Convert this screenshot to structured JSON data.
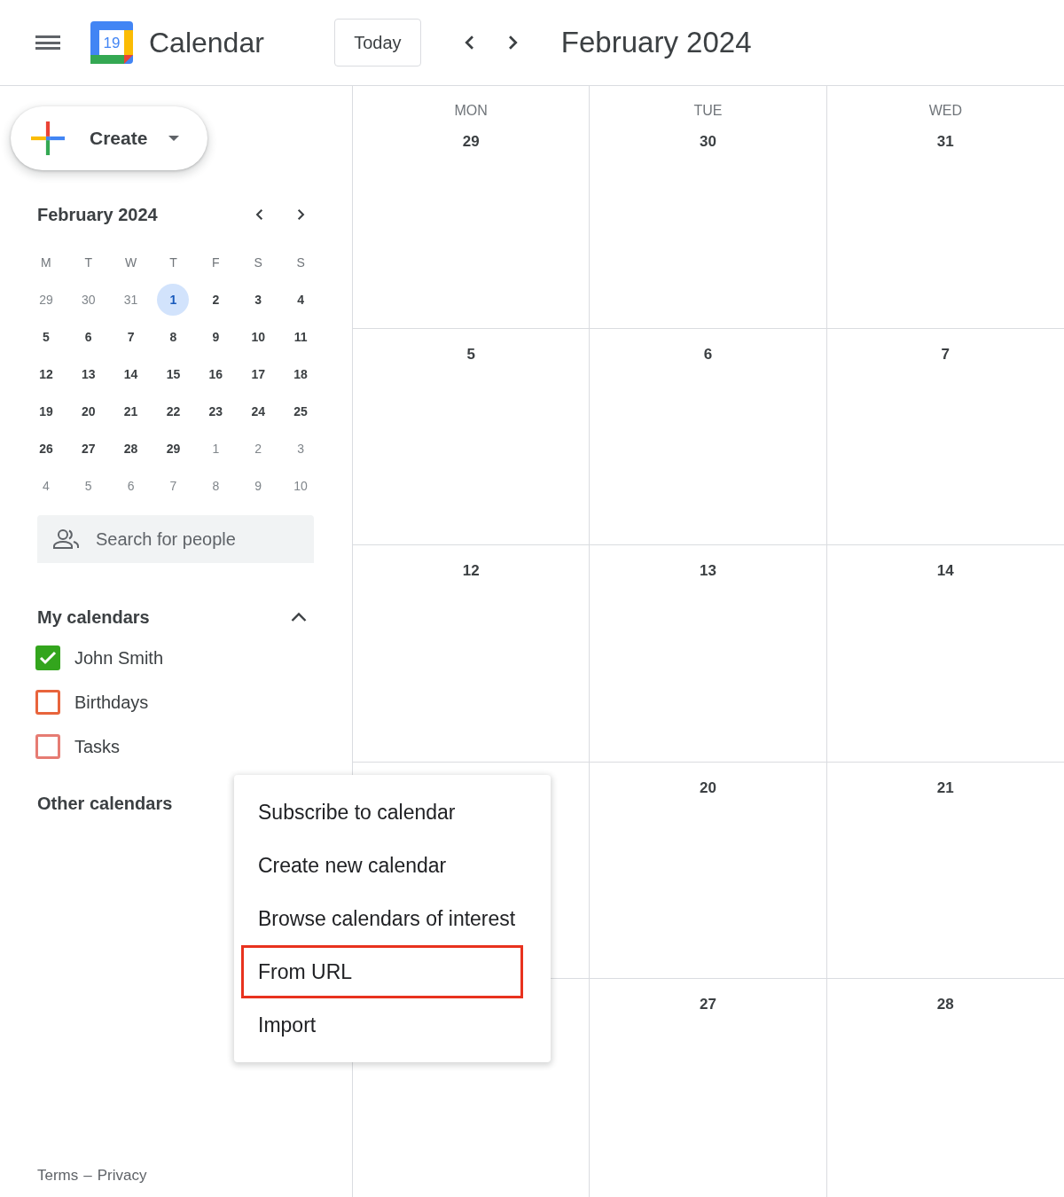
{
  "header": {
    "app_name": "Calendar",
    "logo_day": "19",
    "today_button": "Today",
    "title": "February 2024"
  },
  "create_button": "Create",
  "mini_calendar": {
    "title": "February 2024",
    "weekdays": [
      "M",
      "T",
      "W",
      "T",
      "F",
      "S",
      "S"
    ],
    "weeks": [
      [
        {
          "d": "29",
          "outside": true,
          "selected": false
        },
        {
          "d": "30",
          "outside": true,
          "selected": false
        },
        {
          "d": "31",
          "outside": true,
          "selected": false
        },
        {
          "d": "1",
          "outside": false,
          "selected": true
        },
        {
          "d": "2",
          "outside": false,
          "selected": false
        },
        {
          "d": "3",
          "outside": false,
          "selected": false
        },
        {
          "d": "4",
          "outside": false,
          "selected": false
        }
      ],
      [
        {
          "d": "5",
          "outside": false,
          "selected": false
        },
        {
          "d": "6",
          "outside": false,
          "selected": false
        },
        {
          "d": "7",
          "outside": false,
          "selected": false
        },
        {
          "d": "8",
          "outside": false,
          "selected": false
        },
        {
          "d": "9",
          "outside": false,
          "selected": false
        },
        {
          "d": "10",
          "outside": false,
          "selected": false
        },
        {
          "d": "11",
          "outside": false,
          "selected": false
        }
      ],
      [
        {
          "d": "12",
          "outside": false,
          "selected": false
        },
        {
          "d": "13",
          "outside": false,
          "selected": false
        },
        {
          "d": "14",
          "outside": false,
          "selected": false
        },
        {
          "d": "15",
          "outside": false,
          "selected": false
        },
        {
          "d": "16",
          "outside": false,
          "selected": false
        },
        {
          "d": "17",
          "outside": false,
          "selected": false
        },
        {
          "d": "18",
          "outside": false,
          "selected": false
        }
      ],
      [
        {
          "d": "19",
          "outside": false,
          "selected": false
        },
        {
          "d": "20",
          "outside": false,
          "selected": false
        },
        {
          "d": "21",
          "outside": false,
          "selected": false
        },
        {
          "d": "22",
          "outside": false,
          "selected": false
        },
        {
          "d": "23",
          "outside": false,
          "selected": false
        },
        {
          "d": "24",
          "outside": false,
          "selected": false
        },
        {
          "d": "25",
          "outside": false,
          "selected": false
        }
      ],
      [
        {
          "d": "26",
          "outside": false,
          "selected": false
        },
        {
          "d": "27",
          "outside": false,
          "selected": false
        },
        {
          "d": "28",
          "outside": false,
          "selected": false
        },
        {
          "d": "29",
          "outside": false,
          "selected": false
        },
        {
          "d": "1",
          "outside": true,
          "selected": false
        },
        {
          "d": "2",
          "outside": true,
          "selected": false
        },
        {
          "d": "3",
          "outside": true,
          "selected": false
        }
      ],
      [
        {
          "d": "4",
          "outside": true,
          "selected": false
        },
        {
          "d": "5",
          "outside": true,
          "selected": false
        },
        {
          "d": "6",
          "outside": true,
          "selected": false
        },
        {
          "d": "7",
          "outside": true,
          "selected": false
        },
        {
          "d": "8",
          "outside": true,
          "selected": false
        },
        {
          "d": "9",
          "outside": true,
          "selected": false
        },
        {
          "d": "10",
          "outside": true,
          "selected": false
        }
      ]
    ]
  },
  "people_search": {
    "placeholder": "Search for people"
  },
  "my_calendars": {
    "title": "My calendars",
    "expanded": true,
    "items": [
      {
        "name": "John Smith",
        "checked": true,
        "color": "#33a51d"
      },
      {
        "name": "Birthdays",
        "checked": false,
        "color": "#e8643c"
      },
      {
        "name": "Tasks",
        "checked": false,
        "color": "#e67c73"
      }
    ]
  },
  "other_calendars": {
    "title": "Other calendars"
  },
  "footer": {
    "terms": "Terms",
    "separator": "–",
    "privacy": "Privacy"
  },
  "month_grid": {
    "columns": [
      {
        "day": "MON"
      },
      {
        "day": "TUE"
      },
      {
        "day": "WED"
      }
    ],
    "rows": [
      [
        "29",
        "30",
        "31"
      ],
      [
        "5",
        "6",
        "7"
      ],
      [
        "12",
        "13",
        "14"
      ],
      [
        null,
        "20",
        "21"
      ],
      [
        null,
        "27",
        "28"
      ]
    ]
  },
  "add_menu": {
    "items": [
      {
        "label": "Subscribe to calendar",
        "highlighted": false
      },
      {
        "label": "Create new calendar",
        "highlighted": false
      },
      {
        "label": "Browse calendars of interest",
        "highlighted": false
      },
      {
        "label": "From URL",
        "highlighted": true
      },
      {
        "label": "Import",
        "highlighted": false
      }
    ]
  }
}
